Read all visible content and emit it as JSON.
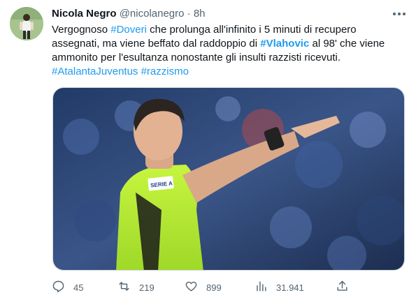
{
  "tweet": {
    "author_name": "Nicola Negro",
    "handle": "@nicolanegro",
    "separator": "·",
    "time": "8h",
    "text": {
      "p1": "Vergognoso ",
      "h1": "#Doveri",
      "p2": " che prolunga all'infinito i 5 minuti di recupero assegnati, ma viene beffato dal raddoppio di ",
      "h2": "#Vlahovic",
      "p3": " al 98' che viene ammonito per l'esultanza nonostante gli insulti razzisti ricevuti.",
      "h3": "#AtalantaJuventus",
      "h4": "#razzismo"
    },
    "media": {
      "description_icon": "photo-image",
      "badge_text": "SERIE A"
    },
    "actions": {
      "replies": "45",
      "retweets": "219",
      "likes": "899",
      "views": "31.941"
    },
    "colors": {
      "link": "#1d9bf0",
      "secondary_text": "#536471",
      "jersey": "#b8f23a"
    },
    "icons": [
      "more-icon",
      "reply-icon",
      "retweet-icon",
      "like-icon",
      "views-icon",
      "share-icon"
    ]
  }
}
